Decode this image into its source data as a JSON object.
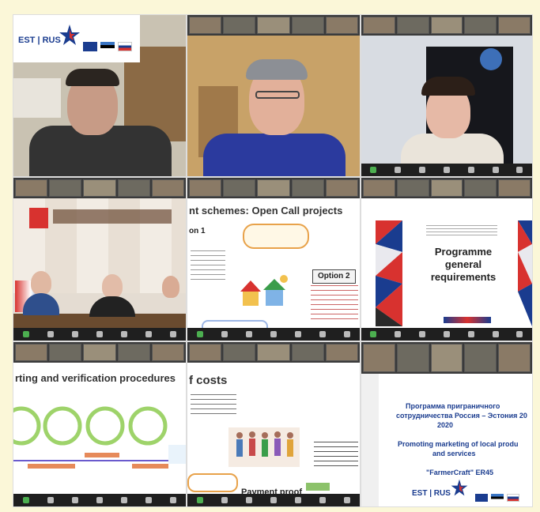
{
  "logos": {
    "top": {
      "text": "EST | RUS"
    },
    "bottom": {
      "text": "EST | RUS"
    }
  },
  "tiles": {
    "t5": {
      "heading": "nt schemes: Open Call projects",
      "option1": "on 1",
      "option2": "Option 2"
    },
    "t6": {
      "title_lines": [
        "Programme",
        "general",
        "requirements"
      ]
    },
    "t7": {
      "heading": "rting and verification procedures"
    },
    "t8": {
      "heading": "f costs",
      "proof": "Payment proof"
    },
    "t9": {
      "line1": "Программа приграничного",
      "line2": "сотрудничества Россия – Эстония 20",
      "line3": "2020",
      "line4": "Promoting marketing of local produ",
      "line5": "and services",
      "line6": "\"FarmerCraft\" ER45"
    }
  },
  "colors": {
    "accent_blue": "#1a3c8f",
    "accent_red": "#d8322f",
    "background": "#fbf7d8"
  }
}
